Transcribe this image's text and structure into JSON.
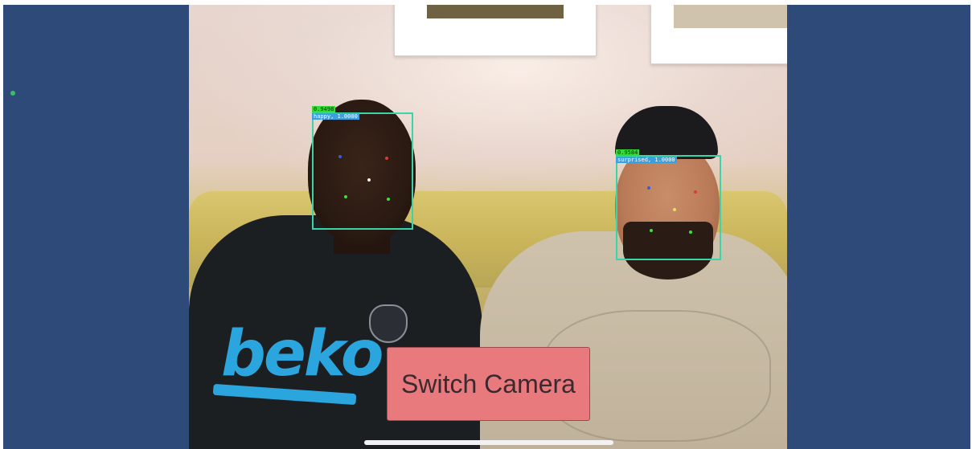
{
  "app": {
    "background_color": "#2e4a78",
    "status_indicator": {
      "icon": "status-dot-icon",
      "color": "#3cbf6a"
    }
  },
  "camera_feed": {
    "detections": [
      {
        "id_label": "0.9498",
        "emotion_label": "happy, 1.0000",
        "box_color": "#3bd3a8"
      },
      {
        "id_label": "0.9584",
        "emotion_label": "surprised, 1.0000",
        "box_color": "#3bd3a8"
      }
    ],
    "scene_text": {
      "shirt_print": "beko"
    }
  },
  "controls": {
    "switch_camera_label": "Switch Camera",
    "switch_camera_color": "#e8797d"
  },
  "system": {
    "home_indicator_color": "#f2f2f4"
  }
}
